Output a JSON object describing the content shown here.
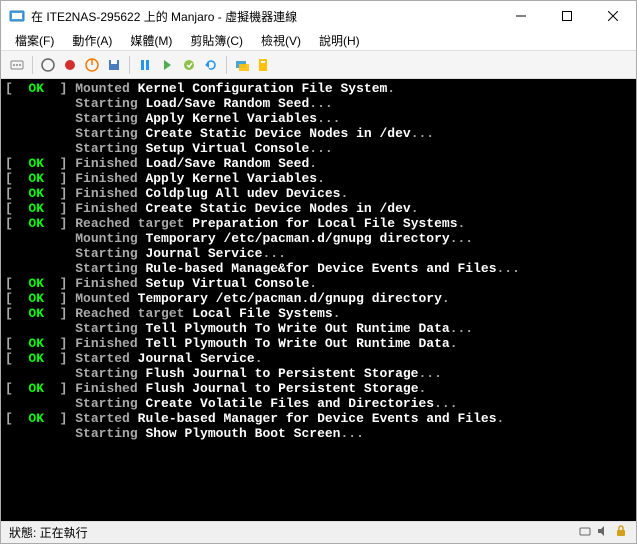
{
  "titlebar": {
    "text": "在 ITE2NAS-295622 上的 Manjaro - 虛擬機器連線"
  },
  "menubar": {
    "file": "檔案(F)",
    "action": "動作(A)",
    "media": "媒體(M)",
    "clipboard": "剪貼簿(C)",
    "view": "檢視(V)",
    "help": "說明(H)"
  },
  "terminal": {
    "lines": [
      {
        "prefix": "[  ",
        "status": "OK",
        "suffix": "  ] ",
        "gray": "Mounted ",
        "white": "Kernel Configuration File System",
        "end": "."
      },
      {
        "prefix": "         ",
        "gray": "Starting ",
        "white": "Load/Save Random Seed",
        "end": "..."
      },
      {
        "prefix": "         ",
        "gray": "Starting ",
        "white": "Apply Kernel Variables",
        "end": "..."
      },
      {
        "prefix": "         ",
        "gray": "Starting ",
        "white": "Create Static Device Nodes in /dev",
        "end": "..."
      },
      {
        "prefix": "         ",
        "gray": "Starting ",
        "white": "Setup Virtual Console",
        "end": "..."
      },
      {
        "prefix": "[  ",
        "status": "OK",
        "suffix": "  ] ",
        "gray": "Finished ",
        "white": "Load/Save Random Seed",
        "end": "."
      },
      {
        "prefix": "[  ",
        "status": "OK",
        "suffix": "  ] ",
        "gray": "Finished ",
        "white": "Apply Kernel Variables",
        "end": "."
      },
      {
        "prefix": "[  ",
        "status": "OK",
        "suffix": "  ] ",
        "gray": "Finished ",
        "white": "Coldplug All udev Devices",
        "end": "."
      },
      {
        "prefix": "[  ",
        "status": "OK",
        "suffix": "  ] ",
        "gray": "Finished ",
        "white": "Create Static Device Nodes in /dev",
        "end": "."
      },
      {
        "prefix": "[  ",
        "status": "OK",
        "suffix": "  ] ",
        "gray": "Reached target ",
        "white": "Preparation for Local File Systems",
        "end": "."
      },
      {
        "prefix": "         ",
        "gray": "Mounting ",
        "white": "Temporary /etc/pacman.d/gnupg directory",
        "end": "..."
      },
      {
        "prefix": "         ",
        "gray": "Starting ",
        "white": "Journal Service",
        "end": "..."
      },
      {
        "prefix": "         ",
        "gray": "Starting ",
        "white": "Rule-based Manage&for Device Events and Files",
        "end": "..."
      },
      {
        "prefix": "[  ",
        "status": "OK",
        "suffix": "  ] ",
        "gray": "Finished ",
        "white": "Setup Virtual Console",
        "end": "."
      },
      {
        "prefix": "[  ",
        "status": "OK",
        "suffix": "  ] ",
        "gray": "Mounted ",
        "white": "Temporary /etc/pacman.d/gnupg directory",
        "end": "."
      },
      {
        "prefix": "[  ",
        "status": "OK",
        "suffix": "  ] ",
        "gray": "Reached target ",
        "white": "Local File Systems",
        "end": "."
      },
      {
        "prefix": "         ",
        "gray": "Starting ",
        "white": "Tell Plymouth To Write Out Runtime Data",
        "end": "..."
      },
      {
        "prefix": "[  ",
        "status": "OK",
        "suffix": "  ] ",
        "gray": "Finished ",
        "white": "Tell Plymouth To Write Out Runtime Data",
        "end": "."
      },
      {
        "prefix": "[  ",
        "status": "OK",
        "suffix": "  ] ",
        "gray": "Started ",
        "white": "Journal Service",
        "end": "."
      },
      {
        "prefix": "         ",
        "gray": "Starting ",
        "white": "Flush Journal to Persistent Storage",
        "end": "..."
      },
      {
        "prefix": "[  ",
        "status": "OK",
        "suffix": "  ] ",
        "gray": "Finished ",
        "white": "Flush Journal to Persistent Storage",
        "end": "."
      },
      {
        "prefix": "         ",
        "gray": "Starting ",
        "white": "Create Volatile Files and Directories",
        "end": "..."
      },
      {
        "prefix": "[  ",
        "status": "OK",
        "suffix": "  ] ",
        "gray": "Started ",
        "white": "Rule-based Manager for Device Events and Files",
        "end": "."
      },
      {
        "prefix": "         ",
        "gray": "Starting ",
        "white": "Show Plymouth Boot Screen",
        "end": "..."
      }
    ]
  },
  "statusbar": {
    "text": "狀態: 正在執行"
  }
}
